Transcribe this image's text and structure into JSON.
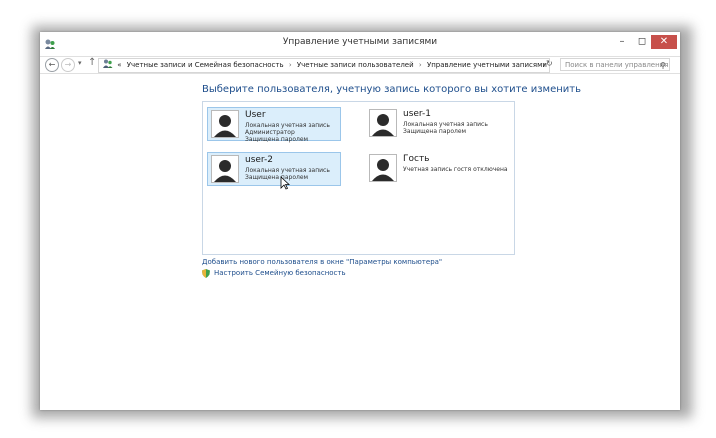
{
  "window": {
    "title": "Управление учетными записями",
    "controls": {
      "minimize": "–",
      "maximize": "◻",
      "close": "✕"
    }
  },
  "addressbar": {
    "breadcrumbs": [
      "«",
      "Учетные записи и Семейная безопасность",
      "Учетные записи пользователей",
      "Управление учетными записями"
    ],
    "search_placeholder": "Поиск в панели управления"
  },
  "main": {
    "heading": "Выберите пользователя, учетную запись которого вы хотите изменить",
    "accounts": [
      {
        "name": "User",
        "lines": [
          "Локальная учетная запись",
          "Администратор",
          "Защищена паролем"
        ],
        "selected": true
      },
      {
        "name": "user-1",
        "lines": [
          "Локальная учетная запись",
          "Защищена паролем"
        ],
        "selected": false
      },
      {
        "name": "user-2",
        "lines": [
          "Локальная учетная запись",
          "Защищена паролем"
        ],
        "selected": true
      },
      {
        "name": "Гость",
        "lines": [
          "Учетная запись гостя отключена"
        ],
        "selected": false
      }
    ],
    "link_add_user": "Добавить нового пользователя в окне \"Параметры компьютера\"",
    "link_family_safety": "Настроить Семейную безопасность"
  },
  "icons": [
    "control-panel-icon",
    "back-arrow-icon",
    "forward-arrow-icon",
    "up-arrow-icon",
    "users-icon",
    "refresh-icon",
    "search-icon",
    "user-avatar-icon",
    "shield-icon",
    "mouse-cursor-icon"
  ],
  "colors": {
    "link": "#1e4e8c",
    "selection": "#dbeefb",
    "close_button": "#c7504b"
  }
}
